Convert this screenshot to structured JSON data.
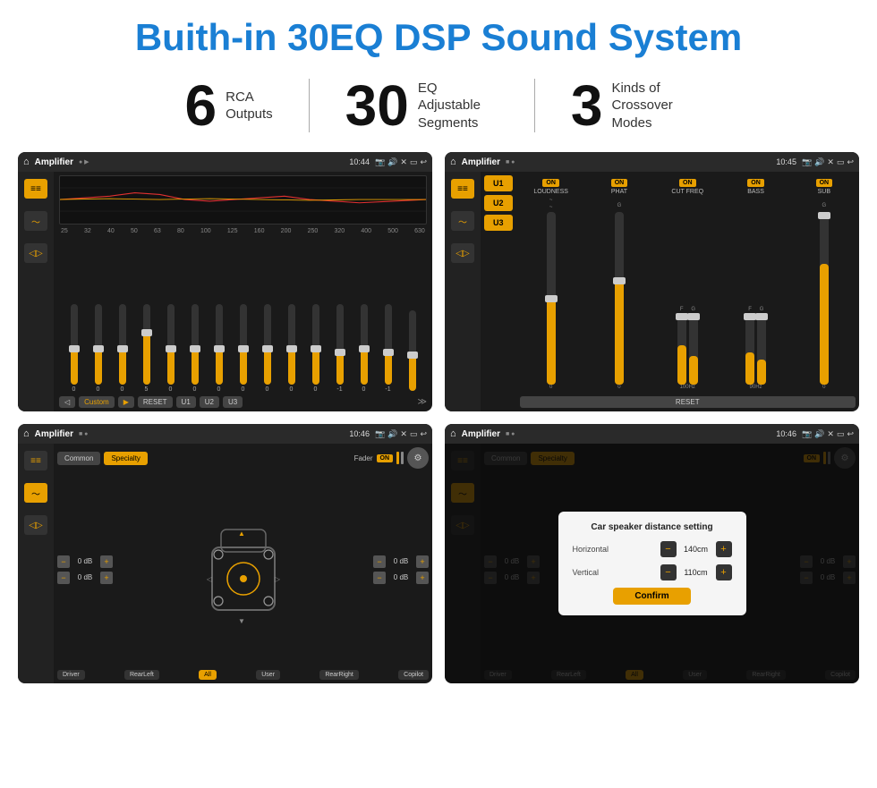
{
  "header": {
    "title": "Buith-in 30EQ DSP Sound System"
  },
  "stats": [
    {
      "number": "6",
      "label": "RCA\nOutputs"
    },
    {
      "number": "30",
      "label": "EQ Adjustable\nSegments"
    },
    {
      "number": "3",
      "label": "Kinds of\nCrossover Modes"
    }
  ],
  "screens": [
    {
      "id": "eq-screen",
      "topbar": {
        "title": "Amplifier",
        "time": "10:44"
      },
      "type": "eq",
      "eq_freqs": [
        "25",
        "32",
        "40",
        "50",
        "63",
        "80",
        "100",
        "125",
        "160",
        "200",
        "250",
        "320",
        "400",
        "500",
        "630"
      ],
      "eq_vals": [
        "0",
        "0",
        "0",
        "5",
        "0",
        "0",
        "0",
        "0",
        "0",
        "0",
        "0",
        "-1",
        "0",
        "-1",
        ""
      ],
      "eq_preset": "Custom",
      "buttons": [
        "RESET",
        "U1",
        "U2",
        "U3"
      ]
    },
    {
      "id": "crossover-screen",
      "topbar": {
        "title": "Amplifier",
        "time": "10:45"
      },
      "type": "crossover",
      "u_presets": [
        "U1",
        "U2",
        "U3"
      ],
      "channels": [
        {
          "label": "LOUDNESS",
          "on": true
        },
        {
          "label": "PHAT",
          "on": true
        },
        {
          "label": "CUT FREQ",
          "on": true
        },
        {
          "label": "BASS",
          "on": true
        },
        {
          "label": "SUB",
          "on": true
        }
      ],
      "reset_label": "RESET"
    },
    {
      "id": "speaker-screen",
      "topbar": {
        "title": "Amplifier",
        "time": "10:46"
      },
      "type": "speaker",
      "tabs": [
        "Common",
        "Specialty"
      ],
      "fader_label": "Fader",
      "fader_on": true,
      "left_dbs": [
        "0 dB",
        "0 dB"
      ],
      "right_dbs": [
        "0 dB",
        "0 dB"
      ],
      "bottom_buttons": [
        "Driver",
        "RearLeft",
        "All",
        "User",
        "RearRight",
        "Copilot"
      ]
    },
    {
      "id": "dialog-screen",
      "topbar": {
        "title": "Amplifier",
        "time": "10:46"
      },
      "type": "speaker-dialog",
      "tabs": [
        "Common",
        "Specialty"
      ],
      "dialog": {
        "title": "Car speaker distance setting",
        "horizontal_label": "Horizontal",
        "horizontal_value": "140cm",
        "vertical_label": "Vertical",
        "vertical_value": "110cm",
        "confirm_label": "Confirm"
      },
      "right_dbs": [
        "0 dB",
        "0 dB"
      ],
      "bottom_buttons": [
        "Driver",
        "RearLeft",
        "All",
        "User",
        "RearRight",
        "Copilot"
      ]
    }
  ]
}
